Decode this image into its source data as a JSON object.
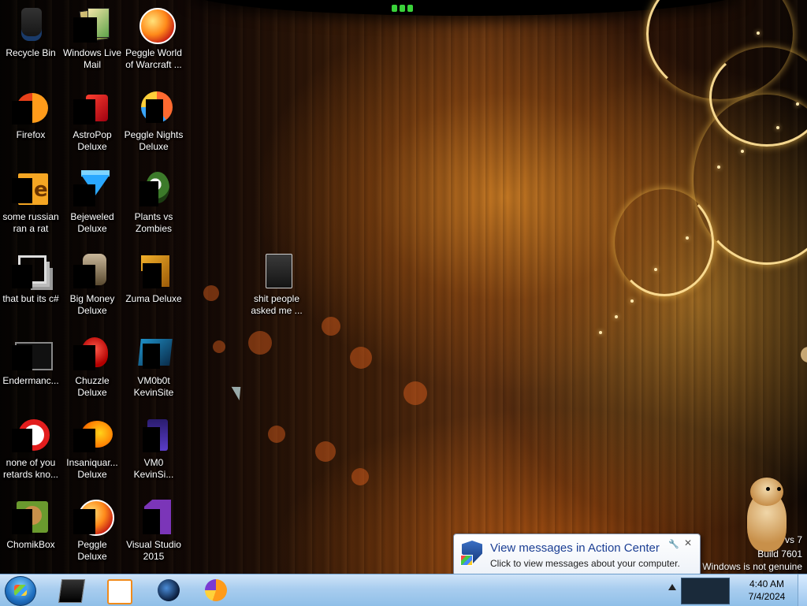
{
  "desktop": {
    "icons": [
      {
        "label": "Recycle Bin",
        "icon": "recycle-bin-icon"
      },
      {
        "label": "Windows Live\nMail",
        "icon": "windows-live-mail-icon"
      },
      {
        "label": "Peggle World\nof Warcraft ...",
        "icon": "peggle-icon"
      },
      {
        "label": "Firefox",
        "icon": "firefox-icon"
      },
      {
        "label": "AstroPop\nDeluxe",
        "icon": "astropop-icon"
      },
      {
        "label": "Peggle Nights\nDeluxe",
        "icon": "peggle-nights-icon"
      },
      {
        "label": "some russian\nran a rat",
        "icon": "shortcut-icon"
      },
      {
        "label": "Bejeweled\nDeluxe",
        "icon": "bejeweled-icon"
      },
      {
        "label": "Plants vs\nZombies",
        "icon": "plants-vs-zombies-icon"
      },
      {
        "label": "that but its c#",
        "icon": "folders-icon"
      },
      {
        "label": "Big Money\nDeluxe",
        "icon": "big-money-icon"
      },
      {
        "label": "Zuma Deluxe",
        "icon": "zuma-icon"
      },
      {
        "label": "Endermanc...",
        "icon": "endermanch-icon"
      },
      {
        "label": "Chuzzle\nDeluxe",
        "icon": "chuzzle-icon"
      },
      {
        "label": "VM0b0t\nKevinSite",
        "icon": "vm0b0t-icon"
      },
      {
        "label": "none of you\nretards kno...",
        "icon": "opera-icon"
      },
      {
        "label": "Insaniquar...\nDeluxe",
        "icon": "insaniquarium-icon"
      },
      {
        "label": "VM0\nKevinSi...",
        "icon": "vm0-icon"
      },
      {
        "label": "ChomikBox",
        "icon": "chomikbox-icon"
      },
      {
        "label": "Peggle Deluxe",
        "icon": "peggle-deluxe-icon"
      },
      {
        "label": "Visual Studio\n2015",
        "icon": "visual-studio-icon"
      },
      {
        "label": "shit people\nasked me ...",
        "icon": "folder-icon"
      }
    ]
  },
  "watermark": {
    "line1": "vs 7",
    "line2": "Build 7601",
    "line3": "Windows is not genuine"
  },
  "notification": {
    "title": "View messages in Action Center",
    "message": "Click to view messages about your computer.",
    "close_glyph": "✕",
    "settings_glyph": "🔧"
  },
  "taskbar": {
    "pinned": [
      {
        "name": "taskbar-terminal-button",
        "icon": "terminal-icon"
      },
      {
        "name": "taskbar-media-player-button",
        "icon": "media-player-icon"
      },
      {
        "name": "taskbar-globe-button",
        "icon": "globe-icon"
      },
      {
        "name": "taskbar-firefox-button",
        "icon": "firefox-icon"
      }
    ],
    "clock": {
      "time": "4:40 AM",
      "date": "7/4/2024"
    }
  },
  "colors": {
    "taskbar": "#a9cdef",
    "notification_title": "#1c3f94",
    "desktop_text": "#ffffff"
  }
}
